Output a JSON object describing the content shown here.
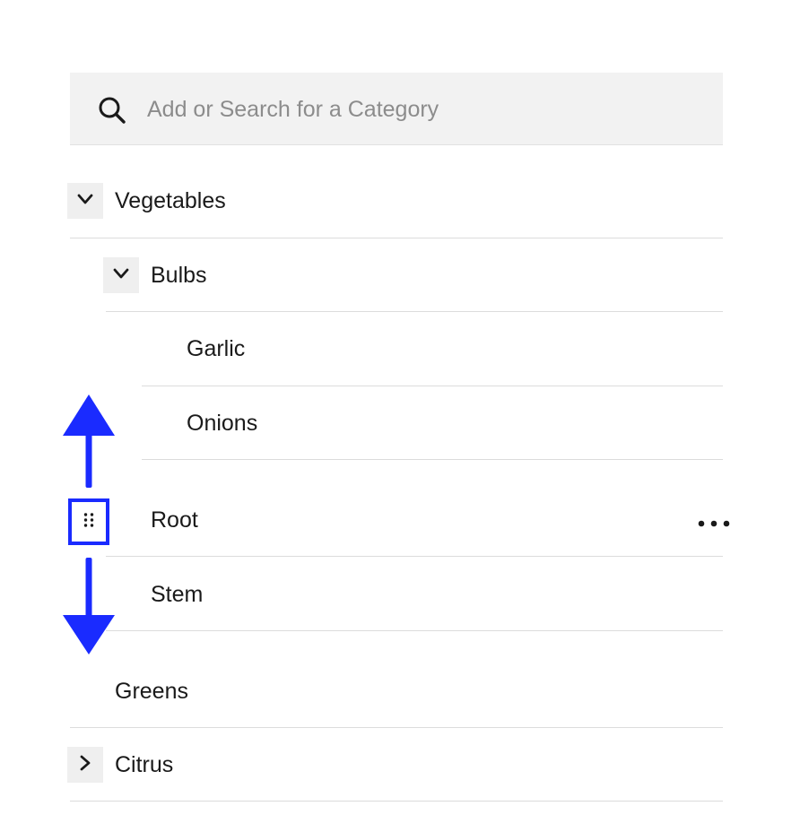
{
  "search": {
    "placeholder": "Add or Search for a Category",
    "value": "",
    "icon": "search-icon"
  },
  "tree": {
    "vegetables": {
      "label": "Vegetables",
      "expanded": true,
      "toggle_icon": "chevron-down-icon"
    },
    "bulbs": {
      "label": "Bulbs",
      "expanded": true,
      "toggle_icon": "chevron-down-icon"
    },
    "garlic": {
      "label": "Garlic"
    },
    "onions": {
      "label": "Onions"
    },
    "root": {
      "label": "Root",
      "drag_icon": "drag-handle-icon",
      "menu_icon": "more-horizontal-icon"
    },
    "stem": {
      "label": "Stem"
    },
    "greens": {
      "label": "Greens"
    },
    "citrus": {
      "label": "Citrus",
      "expanded": false,
      "toggle_icon": "chevron-right-icon"
    }
  },
  "annotation": {
    "arrow_up_icon": "arrow-up-icon",
    "arrow_down_icon": "arrow-down-icon",
    "color": "#1a2bff"
  },
  "colors": {
    "search_bg": "#f2f2f2",
    "toggle_bg": "#efefef",
    "divider": "#dcdcdc",
    "placeholder": "#8c8c8c",
    "text": "#1a1a1a"
  }
}
